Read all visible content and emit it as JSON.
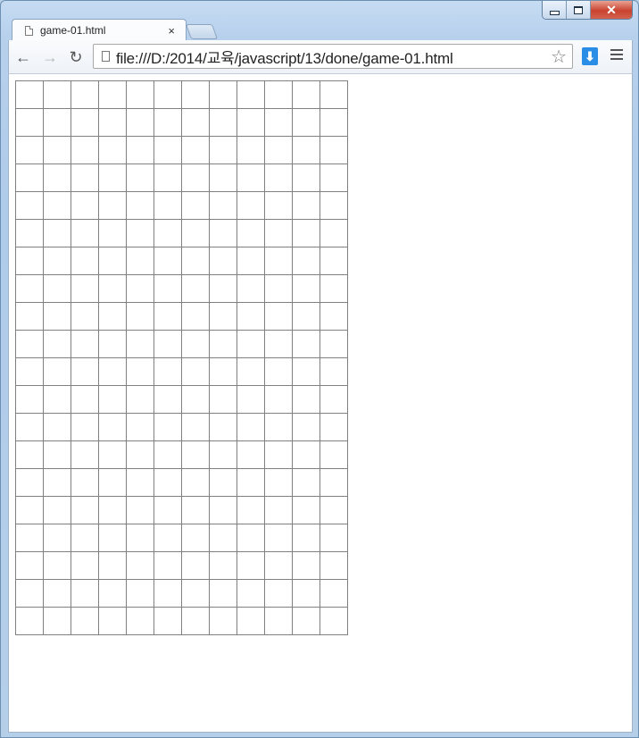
{
  "window": {
    "controls": {
      "minimize_icon": "minimize-icon",
      "maximize_icon": "maximize-icon",
      "close_icon": "close-icon",
      "close_glyph": "✕"
    }
  },
  "tabs": [
    {
      "title": "game-01.html",
      "close_glyph": "×",
      "active": true
    }
  ],
  "toolbar": {
    "back_glyph": "←",
    "forward_glyph": "→",
    "reload_glyph": "↻",
    "url": "file:///D:/2014/교육/javascript/13/done/game-01.html",
    "bookmark_glyph": "☆",
    "download_glyph": "⬇"
  },
  "game": {
    "rows": 20,
    "cols": 12,
    "cell_border_color": "#808080"
  },
  "colors": {
    "frame": "#b9d1ea",
    "download_accent": "#2a8ee6",
    "close_button": "#c94330"
  }
}
